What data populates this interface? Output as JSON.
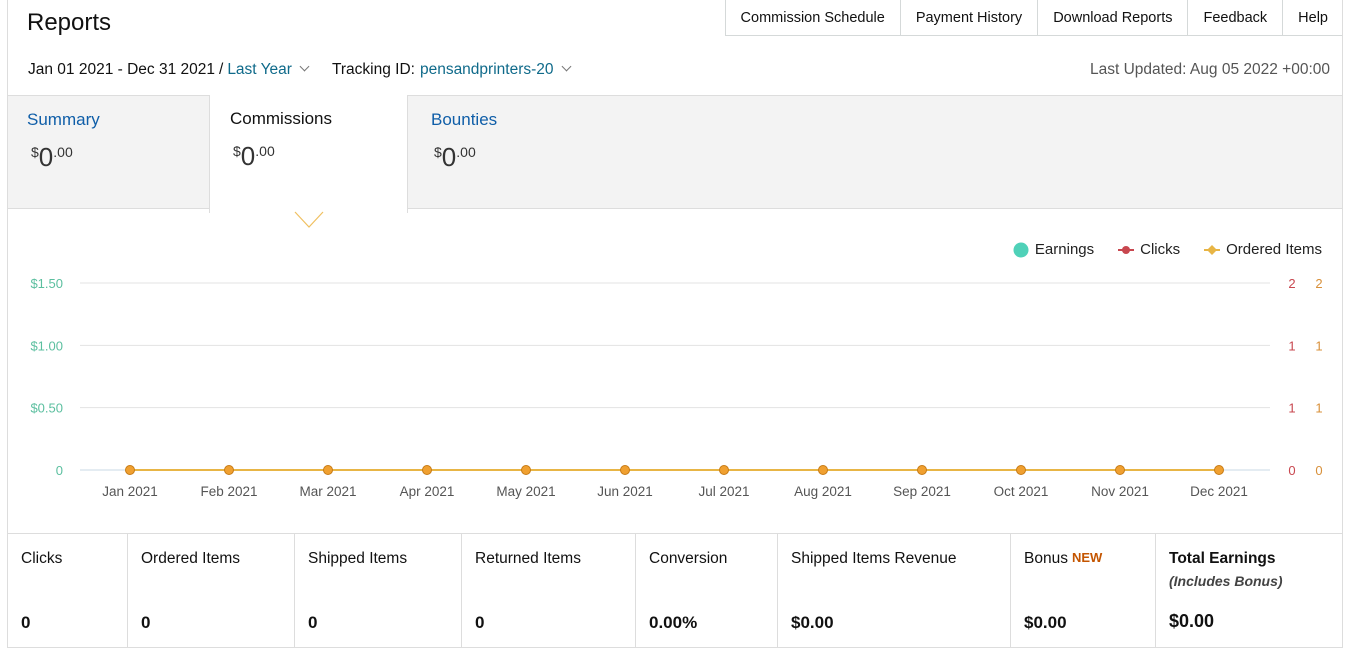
{
  "header": {
    "title": "Reports",
    "nav": [
      "Commission Schedule",
      "Payment History",
      "Download Reports",
      "Feedback",
      "Help"
    ]
  },
  "filter": {
    "date_range": "Jan 01 2021 - Dec 31 2021",
    "separator": "/",
    "period": "Last Year",
    "tracking_label": "Tracking ID:",
    "tracking_id": "pensandprinters-20",
    "last_updated": "Last Updated: Aug 05 2022 +00:00"
  },
  "tabs": [
    {
      "label": "Summary",
      "currency": "$",
      "whole": "0",
      "cents": ".00"
    },
    {
      "label": "Commissions",
      "currency": "$",
      "whole": "0",
      "cents": ".00"
    },
    {
      "label": "Bounties",
      "currency": "$",
      "whole": "0",
      "cents": ".00"
    }
  ],
  "chart_data": {
    "type": "line",
    "x": [
      "Jan 2021",
      "Feb 2021",
      "Mar 2021",
      "Apr 2021",
      "May 2021",
      "Jun 2021",
      "Jul 2021",
      "Aug 2021",
      "Sep 2021",
      "Oct 2021",
      "Nov 2021",
      "Dec 2021"
    ],
    "series": [
      {
        "name": "Earnings",
        "color": "#4fd1b8",
        "values": [
          0,
          0,
          0,
          0,
          0,
          0,
          0,
          0,
          0,
          0,
          0,
          0
        ]
      },
      {
        "name": "Clicks",
        "color": "#c8474f",
        "values": [
          0,
          0,
          0,
          0,
          0,
          0,
          0,
          0,
          0,
          0,
          0,
          0
        ]
      },
      {
        "name": "Ordered Items",
        "color": "#e8b545",
        "values": [
          0,
          0,
          0,
          0,
          0,
          0,
          0,
          0,
          0,
          0,
          0,
          0
        ]
      }
    ],
    "y_left_ticks": [
      "0",
      "$0.50",
      "$1.00",
      "$1.50"
    ],
    "y_right_ticks_clicks": [
      "0",
      "1",
      "1",
      "2"
    ],
    "y_right_ticks_ordered": [
      "0",
      "1",
      "1",
      "2"
    ],
    "ylim": [
      0,
      1.5
    ],
    "grid": true,
    "legend_position": "top-right"
  },
  "stats": [
    {
      "label": "Clicks",
      "value": "0"
    },
    {
      "label": "Ordered Items",
      "value": "0"
    },
    {
      "label": "Shipped Items",
      "value": "0"
    },
    {
      "label": "Returned Items",
      "value": "0"
    },
    {
      "label": "Conversion",
      "value": "0.00%"
    },
    {
      "label": "Shipped Items Revenue",
      "value": "$0.00"
    },
    {
      "label": "Bonus",
      "badge": "NEW",
      "value": "$0.00"
    },
    {
      "label": "Total Earnings",
      "sublabel": "(Includes Bonus)",
      "value": "$0.00"
    }
  ]
}
